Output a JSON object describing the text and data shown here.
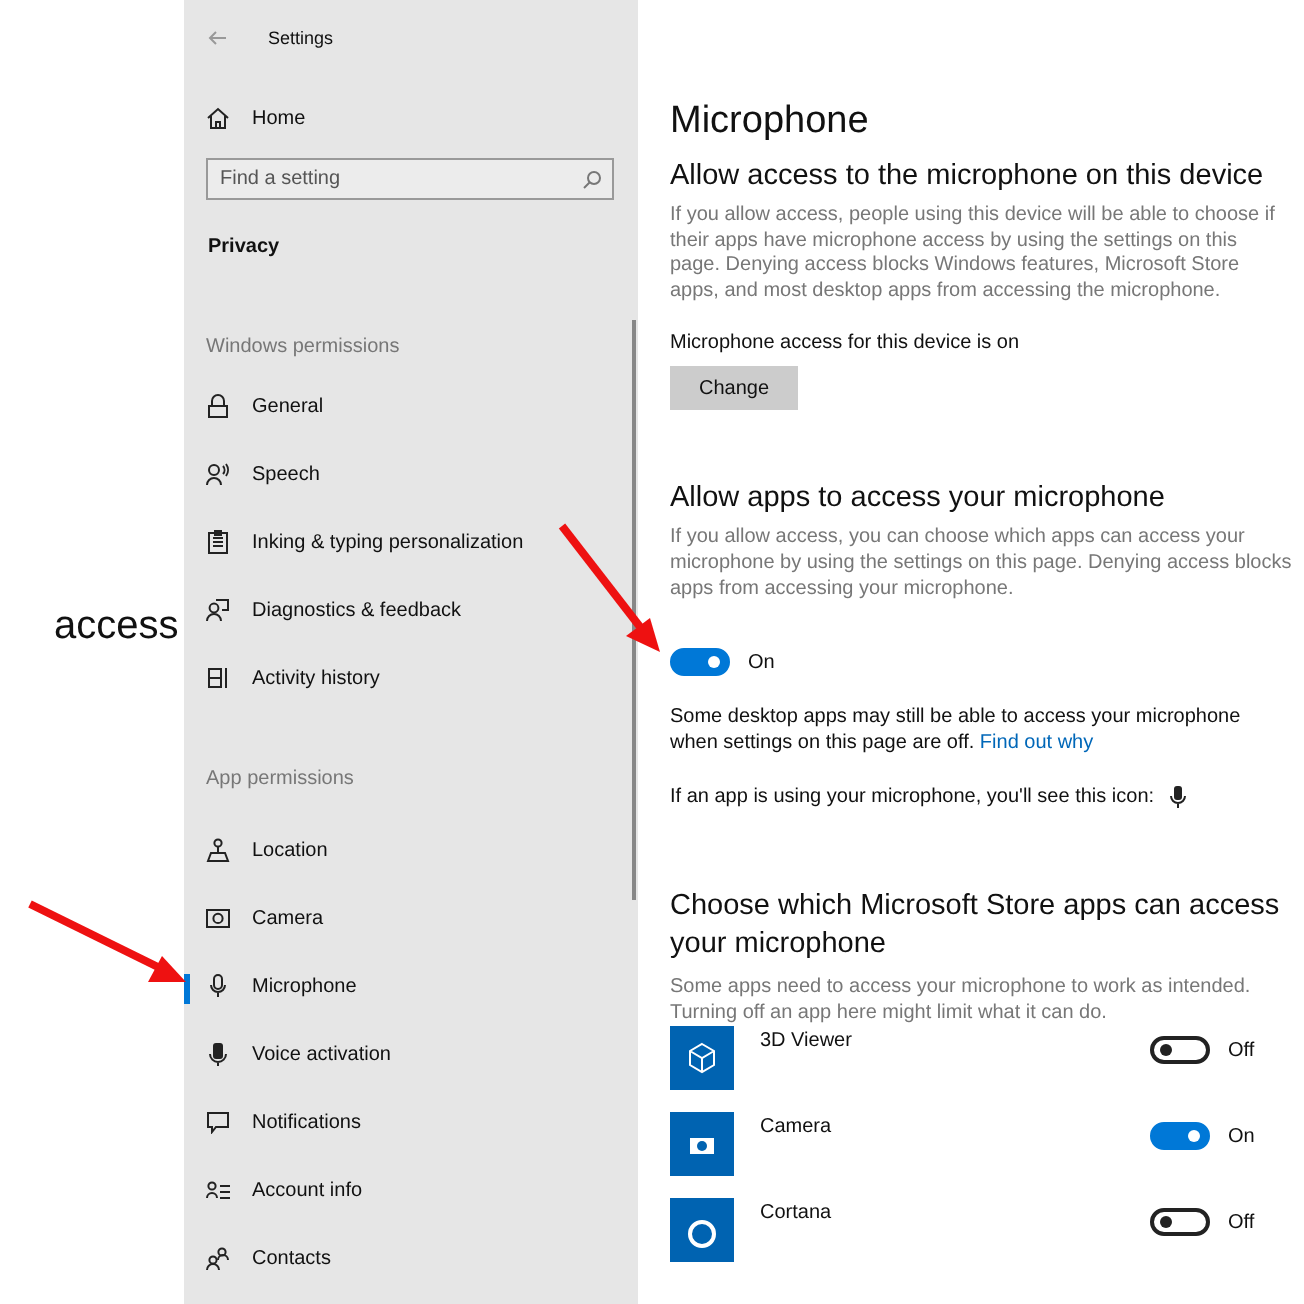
{
  "slide_text": "access",
  "sidebar": {
    "title": "Settings",
    "home": "Home",
    "search": {
      "placeholder": "Find a setting"
    },
    "category": "Privacy",
    "groups": [
      {
        "heading": "Windows permissions",
        "items": [
          {
            "label": "General",
            "selected": false
          },
          {
            "label": "Speech",
            "selected": false
          },
          {
            "label": "Inking & typing personalization",
            "selected": false
          },
          {
            "label": "Diagnostics & feedback",
            "selected": false
          },
          {
            "label": "Activity history",
            "selected": false
          }
        ]
      },
      {
        "heading": "App permissions",
        "items": [
          {
            "label": "Location",
            "selected": false
          },
          {
            "label": "Camera",
            "selected": false
          },
          {
            "label": "Microphone",
            "selected": true
          },
          {
            "label": "Voice activation",
            "selected": false
          },
          {
            "label": "Notifications",
            "selected": false
          },
          {
            "label": "Account info",
            "selected": false
          },
          {
            "label": "Contacts",
            "selected": false
          }
        ]
      }
    ]
  },
  "main": {
    "title": "Microphone",
    "device_section": {
      "heading": "Allow access to the microphone on this device",
      "description": "If you allow access, people using this device will be able to choose if their apps have microphone access by using the settings on this page. Denying access blocks Windows features, Microsoft Store apps, and most desktop apps from accessing the microphone.",
      "status": "Microphone access for this device is on",
      "button": "Change"
    },
    "apps_section": {
      "heading": "Allow apps to access your microphone",
      "description": "If you allow access, you can choose which apps can access your microphone by using the settings on this page. Denying access blocks apps from accessing your microphone.",
      "toggle": {
        "on": true,
        "label": "On"
      },
      "note": "Some desktop apps may still be able to access your microphone when settings on this page are off.",
      "link": "Find out why",
      "icon_note": "If an app is using your microphone, you'll see this icon:"
    },
    "store_section": {
      "heading": "Choose which Microsoft Store apps can access your microphone",
      "description": "Some apps need to access your microphone to work as intended. Turning off an app here might limit what it can do.",
      "apps": [
        {
          "name": "3D Viewer",
          "on": false,
          "state": "Off"
        },
        {
          "name": "Camera",
          "on": true,
          "state": "On"
        },
        {
          "name": "Cortana",
          "on": false,
          "state": "Off"
        }
      ]
    }
  }
}
